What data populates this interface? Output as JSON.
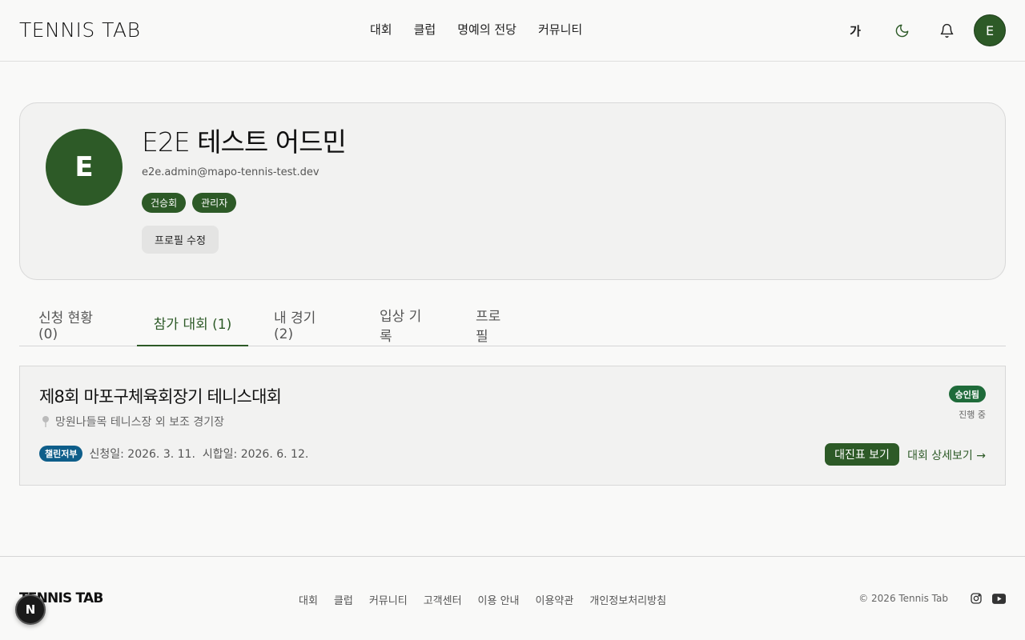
{
  "header": {
    "logo": "TENNIS TAB",
    "nav": [
      "대회",
      "클럽",
      "명예의 전당",
      "커뮤니티"
    ],
    "font_toggle": "가",
    "user_initial": "E"
  },
  "profile": {
    "initial": "E",
    "name": "E2E 테스트 어드민",
    "email": "e2e.admin@mapo-tennis-test.dev",
    "badges": [
      "건승회",
      "관리자"
    ],
    "edit_label": "프로필 수정"
  },
  "tabs": [
    {
      "label": "신청 현황 (0)",
      "active": false
    },
    {
      "label": "참가 대회 (1)",
      "active": true
    },
    {
      "label": "내 경기 (2)",
      "active": false
    },
    {
      "label": "입상 기록",
      "active": false
    },
    {
      "label": "프로필",
      "active": false
    }
  ],
  "tournament": {
    "title": "제8회 마포구체육회장기 테니스대회",
    "location": "망원나들목 테니스장 외 보조 경기장",
    "division": "챌린저부",
    "applied": "신청일: 2026. 3. 11.",
    "match_date": "시합일: 2026. 6. 12.",
    "status": "승인됨",
    "progress": "진행 중",
    "draw_button": "대진표 보기",
    "detail_link": "대회 상세보기 →"
  },
  "footer": {
    "logo": "TENNIS TAB",
    "links": [
      "대회",
      "클럽",
      "커뮤니티",
      "고객센터",
      "이용 안내",
      "이용약관",
      "개인정보처리방침"
    ],
    "copyright": "© 2026 Tennis Tab"
  },
  "dev_badge": "N",
  "colors": {
    "accent": "#2d5a27",
    "division": "#0e5e8a",
    "status": "#1f6b3a"
  },
  "icons": [
    "moon-icon",
    "bell-icon",
    "location-pin-icon",
    "instagram-icon",
    "youtube-icon"
  ]
}
